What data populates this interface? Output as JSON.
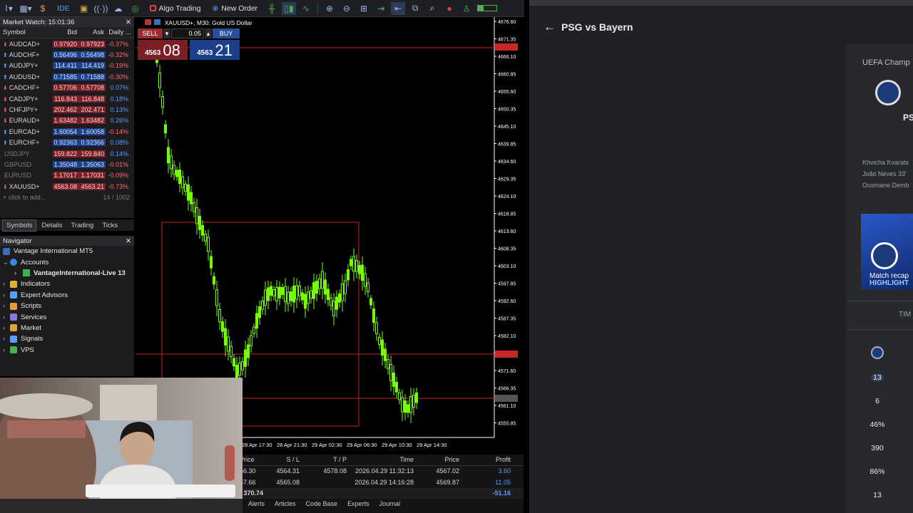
{
  "toolbar": {
    "algo": "Algo Trading",
    "new_order": "New Order",
    "ide": "IDE"
  },
  "market_watch": {
    "title": "Market Watch: 15:01:36",
    "headers": {
      "symbol": "Symbol",
      "bid": "Bid",
      "ask": "Ask",
      "daily": "Daily ..."
    },
    "rows": [
      {
        "symbol": "AUDCAD+",
        "bid": "0.97920",
        "ask": "0.97923",
        "daily": "-0.37%",
        "dir": "dn"
      },
      {
        "symbol": "AUDCHF+",
        "bid": "0.56496",
        "ask": "0.56498",
        "daily": "-0.32%",
        "dir": "up"
      },
      {
        "symbol": "AUDJPY+",
        "bid": "114.411",
        "ask": "114.419",
        "daily": "-0.19%",
        "dir": "up"
      },
      {
        "symbol": "AUDUSD+",
        "bid": "0.71585",
        "ask": "0.71588",
        "daily": "-0.30%",
        "dir": "up"
      },
      {
        "symbol": "CADCHF+",
        "bid": "0.57706",
        "ask": "0.57708",
        "daily": "0.07%",
        "dir": "dn"
      },
      {
        "symbol": "CADJPY+",
        "bid": "116.843",
        "ask": "116.848",
        "daily": "0.18%",
        "dir": "dn"
      },
      {
        "symbol": "CHFJPY+",
        "bid": "202.462",
        "ask": "202.471",
        "daily": "0.13%",
        "dir": "dn"
      },
      {
        "symbol": "EURAUD+",
        "bid": "1.63482",
        "ask": "1.63482",
        "daily": "0.26%",
        "dir": "dn"
      },
      {
        "symbol": "EURCAD+",
        "bid": "1.60054",
        "ask": "1.60058",
        "daily": "-0.14%",
        "dir": "up"
      },
      {
        "symbol": "EURCHF+",
        "bid": "0.92363",
        "ask": "0.92366",
        "daily": "0.08%",
        "dir": "up"
      },
      {
        "symbol": "USDJPY",
        "bid": "159.822",
        "ask": "159.840",
        "daily": "0.14%",
        "dir": "dn",
        "dim": true
      },
      {
        "symbol": "GBPUSD",
        "bid": "1.35048",
        "ask": "1.35063",
        "daily": "-0.01%",
        "dir": "up",
        "dim": true
      },
      {
        "symbol": "EURUSD",
        "bid": "1.17017",
        "ask": "1.17031",
        "daily": "-0.09%",
        "dir": "dn",
        "dim": true
      },
      {
        "symbol": "XAUUSD+",
        "bid": "4563.08",
        "ask": "4563.21",
        "daily": "-0.73%",
        "dir": "dn"
      }
    ],
    "add": "click to add...",
    "count": "14 / 1002"
  },
  "mw_tabs": [
    "Symbols",
    "Details",
    "Trading",
    "Ticks"
  ],
  "navigator": {
    "title": "Navigator",
    "root": "Vantage International MT5",
    "accounts": "Accounts",
    "account": "VantageInternational-Live 13",
    "items": [
      "Indicators",
      "Expert Advisors",
      "Scripts",
      "Services",
      "Market",
      "Signals",
      "VPS"
    ]
  },
  "chart": {
    "title": "XAUUSD+, M30:  Gold US Dollar",
    "sell": "SELL",
    "buy": "BUY",
    "lot": "0.05",
    "bid_small": "4563",
    "bid_big": "08",
    "ask_small": "4563",
    "ask_big": "21",
    "price_labels": [
      "4676.60",
      "4671.35",
      "4666.10",
      "4660.85",
      "4655.60",
      "4650.35",
      "4645.10",
      "4639.85",
      "4634.60",
      "4629.35",
      "4624.10",
      "4618.85",
      "4613.60",
      "4608.35",
      "4603.10",
      "4597.85",
      "4592.60",
      "4587.35",
      "4582.10",
      "4576.85",
      "4571.60",
      "4566.35",
      "4561.10",
      "4555.85"
    ],
    "time_labels": [
      "28 Apr 17:30",
      "28 Apr 21:30",
      "29 Apr 02:30",
      "29 Apr 06:30",
      "29 Apr 10:30",
      "29 Apr 14:30"
    ]
  },
  "positions": {
    "headers": [
      "Price",
      "S / L",
      "T / P",
      "Time",
      "Price",
      "Profit"
    ],
    "rows": [
      [
        "56.30",
        "4564.31",
        "4578.08",
        "2026.04.29 11:32:13",
        "4567.02",
        "3.60"
      ],
      [
        "57.66",
        "4565.08",
        "",
        "2026.04.29 14:16:28",
        "4569.87",
        "11.05"
      ]
    ],
    "balance": ": 370.74",
    "total": "-51.16",
    "tabs": [
      "Alerts",
      "Articles",
      "Code Base",
      "Experts",
      "Journal"
    ]
  },
  "browser": {
    "title": "PSG vs Bayern",
    "league": "UEFA Champ",
    "team": "PS",
    "scorers": [
      "Khvicha Kvarats",
      "João Neves 33'",
      "Ousmane Demb"
    ],
    "video_label": "Match recap",
    "video_sub": "HIGHLIGHT",
    "stats_header": "TIM",
    "stats": [
      "13",
      "6",
      "46%",
      "390",
      "86%",
      "13"
    ]
  }
}
